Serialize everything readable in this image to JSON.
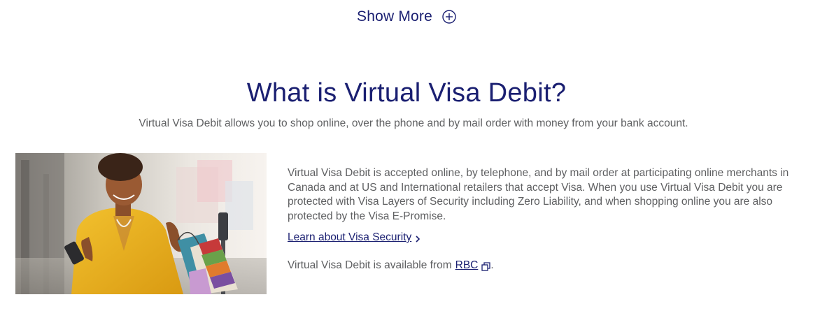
{
  "show_more": {
    "label": "Show More",
    "icon": "plus-circle-icon"
  },
  "section": {
    "title": "What is Virtual Visa Debit?",
    "subtitle": "Virtual Visa Debit allows you to shop online, over the phone and by mail order with money from your bank account."
  },
  "hero_image": {
    "description_icon": "photo-woman-shopping-with-phone"
  },
  "content": {
    "body": "Virtual Visa Debit is accepted online, by telephone, and by mail order at participating online merchants in Canada and at US and International retailers that accept Visa. When you use Virtual Visa Debit you are protected with Visa Layers of Security including Zero Liability, and when shopping online you are also protected by the Visa E-Promise.",
    "learn_link": "Learn about Visa Security",
    "learn_link_icon": "chevron-right-icon",
    "available_prefix": "Virtual Visa Debit is available from",
    "available_link": "RBC",
    "available_link_icon": "external-link-icon",
    "available_suffix": "."
  },
  "colors": {
    "brand_navy": "#1a1f71",
    "text_gray": "#5f6062",
    "background": "#ffffff"
  }
}
